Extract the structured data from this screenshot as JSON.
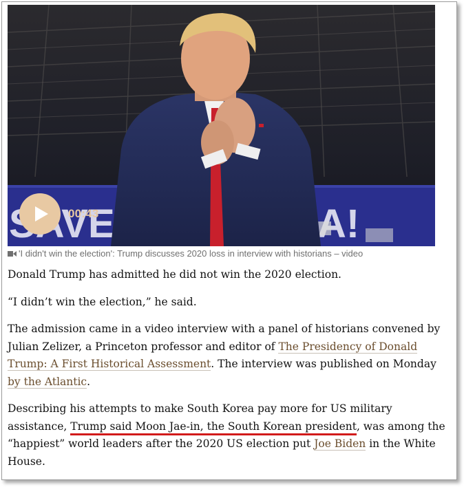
{
  "video": {
    "duration": "00:43",
    "banner_left": "SAVE",
    "banner_right": "A!",
    "caption": "'I didn't win the election': Trump discusses 2020 loss in interview with historians – video"
  },
  "article": {
    "p1": "Donald Trump has admitted he did not win the 2020 election.",
    "p2": "“I didn’t win the election,” he said.",
    "p3": {
      "before": "The admission came in a video interview with a panel of historians convened by Julian Zelizer, a Princeton professor and editor of ",
      "link1": "The Presidency of Donald Trump: A First Historical Assessment",
      "middle": ". The interview was published on Monday ",
      "link2": "by the Atlantic",
      "after": "."
    },
    "p4": {
      "before": "Describing his attempts to make South Korea pay more for US military assistance, ",
      "highlight": "Trump said Moon Jae-in, the South Korean president",
      "middle": ", was among the “happiest” world leaders after the 2020 US election put ",
      "link": "Joe Biden",
      "after": " in the White House."
    }
  },
  "colors": {
    "accent_play": "#e8c9a3",
    "link": "#6b4e2e",
    "highlight_underline": "#d11a1a",
    "caption_text": "#707070",
    "banner_blue": "#2a2f8e"
  },
  "icons": [
    "play-icon",
    "video-camera-icon"
  ]
}
